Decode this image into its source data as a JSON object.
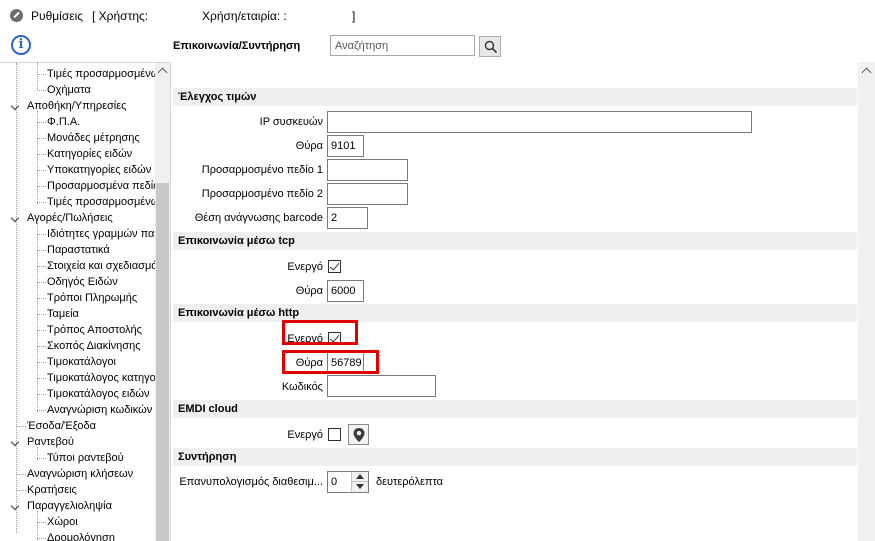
{
  "window": {
    "app_title": "Ρυθμίσεις",
    "user_label": "[ Χρήστης:",
    "user_company_label": "Χρήση/εταιρία: :",
    "closing_bracket": "]"
  },
  "header": {
    "page_title": "Επικοινωνία/Συντήρηση",
    "search_placeholder": "Αναζήτηση"
  },
  "sidebar": {
    "items": [
      {
        "label": "Τιμές προσαρμοσμένω",
        "level": 2
      },
      {
        "label": "Οχήματα",
        "level": 2
      },
      {
        "label": "Αποθήκη/Υπηρεσίες",
        "level": 1,
        "expanded": true
      },
      {
        "label": "Φ.Π.Α.",
        "level": 2
      },
      {
        "label": "Μονάδες μέτρησης",
        "level": 2
      },
      {
        "label": "Κατηγορίες ειδών",
        "level": 2
      },
      {
        "label": "Υποκατηγορίες ειδών",
        "level": 2
      },
      {
        "label": "Προσαρμοσμένα πεδίω",
        "level": 2
      },
      {
        "label": "Τιμές προσαρμοσμένω",
        "level": 2
      },
      {
        "label": "Αγορές/Πωλήσεις",
        "level": 1,
        "expanded": true
      },
      {
        "label": "Ιδιότητες γραμμών πα",
        "level": 2
      },
      {
        "label": "Παραστατικά",
        "level": 2
      },
      {
        "label": "Στοιχεία και σχεδιασμό",
        "level": 2
      },
      {
        "label": "Οδηγός Ειδών",
        "level": 2
      },
      {
        "label": "Τρόποι Πληρωμής",
        "level": 2
      },
      {
        "label": "Ταμεία",
        "level": 2
      },
      {
        "label": "Τρόπος Αποστολής",
        "level": 2
      },
      {
        "label": "Σκοπός Διακίνησης",
        "level": 2
      },
      {
        "label": "Τιμοκατάλογοι",
        "level": 2
      },
      {
        "label": "Τιμοκατάλογος κατηγο",
        "level": 2
      },
      {
        "label": "Τιμοκατάλογος ειδών",
        "level": 2
      },
      {
        "label": "Αναγνώριση κωδικών",
        "level": 2
      },
      {
        "label": "Έσοδα/Έξοδα",
        "level": 1,
        "expanded": false
      },
      {
        "label": "Ραντεβού",
        "level": 1,
        "expanded": true
      },
      {
        "label": "Τύποι ραντεβού",
        "level": 2
      },
      {
        "label": "Αναγνώριση κλήσεων",
        "level": 1,
        "expanded": false
      },
      {
        "label": "Κρατήσεις",
        "level": 1,
        "expanded": false
      },
      {
        "label": "Παραγγελιοληψία",
        "level": 1,
        "expanded": true
      },
      {
        "label": "Χώροι",
        "level": 2
      },
      {
        "label": "Δρομολόγηση",
        "level": 2
      }
    ]
  },
  "price_check": {
    "section_title": "Έλεγχος τιμών",
    "ip_label": "IP συσκευών",
    "ip_value": "",
    "port_label": "Θύρα",
    "port_value": "9101",
    "custom1_label": "Προσαρμοσμένο πεδίο 1",
    "custom1_value": "",
    "custom2_label": "Προσαρμοσμένο πεδίο 2",
    "custom2_value": "",
    "barcode_pos_label": "Θέση ανάγνωσης barcode",
    "barcode_pos_value": "2"
  },
  "tcp": {
    "section_title": "Επικοινωνία μέσω tcp",
    "active_label": "Ενεργό",
    "active_checked": true,
    "port_label": "Θύρα",
    "port_value": "6000"
  },
  "http": {
    "section_title": "Επικοινωνία μέσω http",
    "active_label": "Ενεργό",
    "active_checked": true,
    "port_label": "Θύρα",
    "port_value": "56789",
    "code_label": "Κωδικός",
    "code_value": ""
  },
  "emdi": {
    "section_title": "EMDI cloud",
    "active_label": "Ενεργό",
    "active_checked": false,
    "location_icon": "map-pin-icon"
  },
  "maintenance": {
    "section_title": "Συντήρηση",
    "recalc_label": "Επανυπολογισμός διαθεσιμ...",
    "recalc_value": "0",
    "unit_label": "δευτερόλεπτα"
  },
  "colors": {
    "highlight": "#e00000",
    "info_blue": "#2a66c7",
    "section_bg": "#efefef"
  }
}
